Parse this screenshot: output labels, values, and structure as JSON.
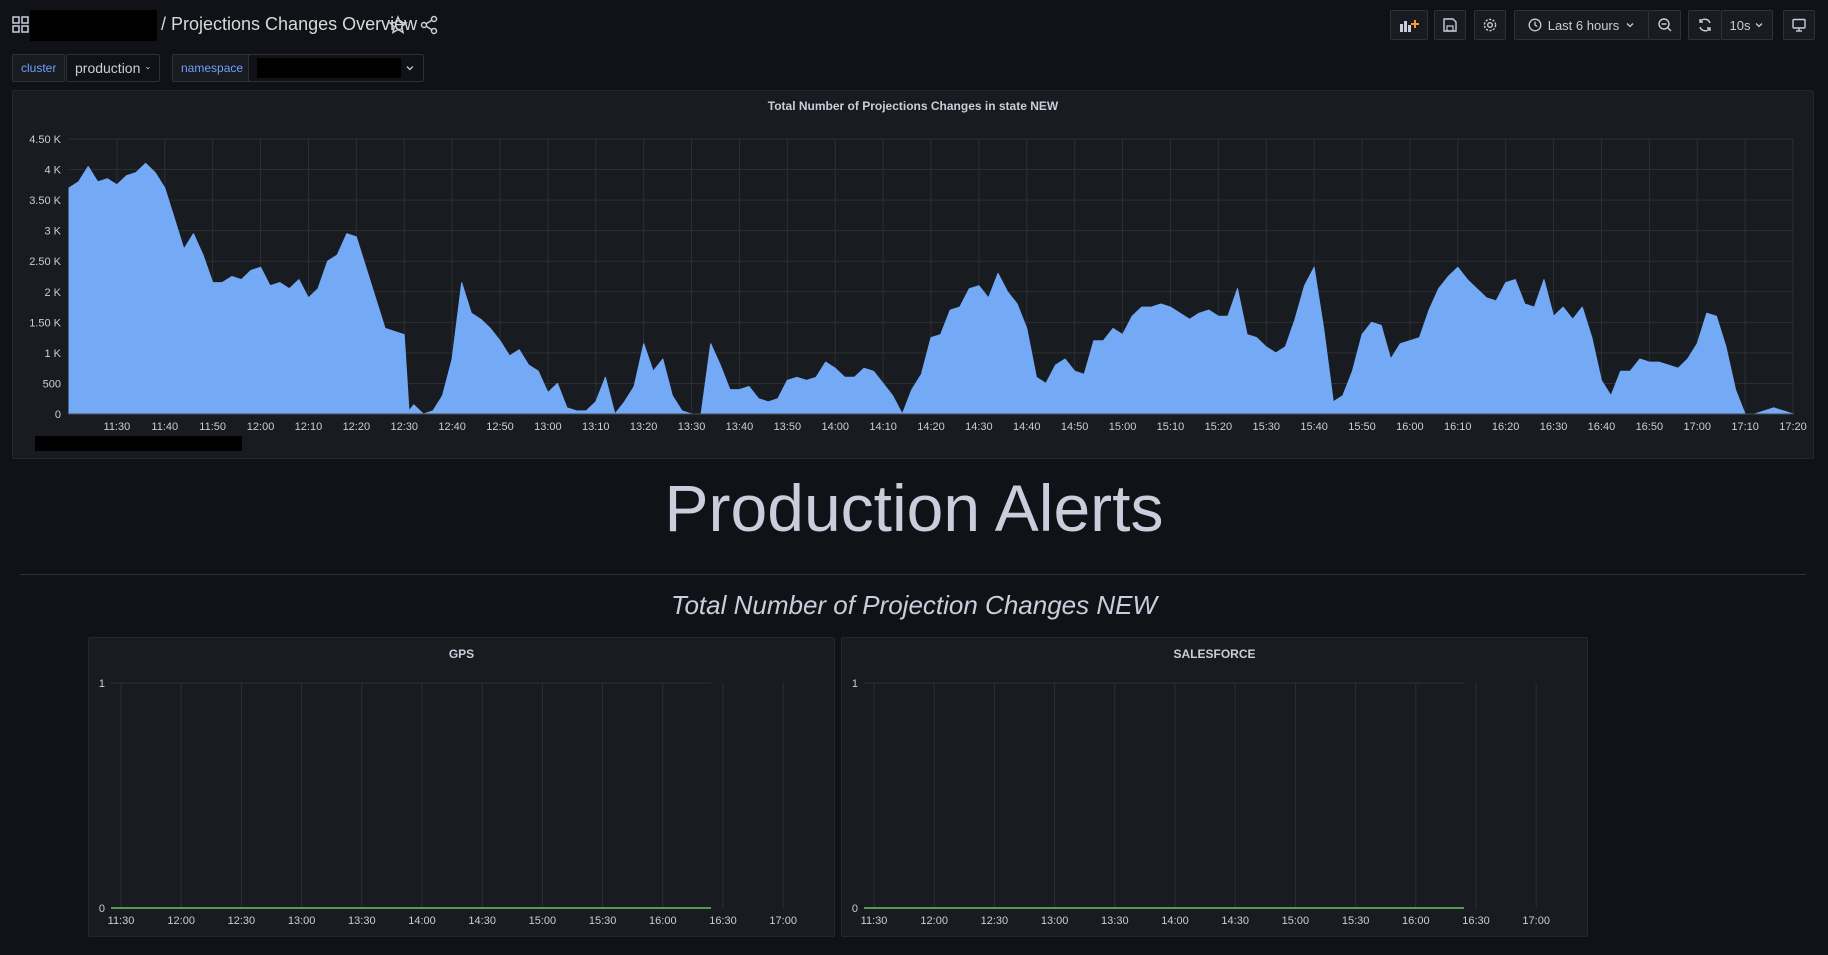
{
  "topnav": {
    "title": "/ Projections Changes Overview",
    "time_range": "Last 6 hours",
    "refresh_interval": "10s"
  },
  "variables": [
    {
      "label": "cluster",
      "value": "production"
    },
    {
      "label": "namespace",
      "value": ""
    }
  ],
  "heading": "Production Alerts",
  "subheading": "Total Number of Projection Changes NEW",
  "main_panel": {
    "title": "Total Number of Projections Changes in state NEW"
  },
  "gps_panel": {
    "title": "GPS"
  },
  "salesforce_panel": {
    "title": "SALESFORCE"
  },
  "colors": {
    "series": "#73a9f5",
    "flatline": "#73bf69",
    "background": "#111217",
    "panel": "#181b1f"
  },
  "chart_data": [
    {
      "type": "area",
      "title": "Total Number of Projections Changes in state NEW",
      "yticks": [
        "0",
        "500",
        "1 K",
        "1.50 K",
        "2 K",
        "2.50 K",
        "3 K",
        "3.50 K",
        "4 K",
        "4.50 K"
      ],
      "ylim": [
        0,
        4500
      ],
      "xlim": [
        "11:20",
        "17:20"
      ],
      "xticks": [
        "11:30",
        "11:40",
        "11:50",
        "12:00",
        "12:10",
        "12:20",
        "12:30",
        "12:40",
        "12:50",
        "13:00",
        "13:10",
        "13:20",
        "13:30",
        "13:40",
        "13:50",
        "14:00",
        "14:10",
        "14:20",
        "14:30",
        "14:40",
        "14:50",
        "15:00",
        "15:10",
        "15:20",
        "15:30",
        "15:40",
        "15:50",
        "16:00",
        "16:10",
        "16:20",
        "16:30",
        "16:40",
        "16:50",
        "17:00",
        "17:10",
        "17:20"
      ],
      "x": [
        "11:20",
        "11:22",
        "11:24",
        "11:26",
        "11:28",
        "11:30",
        "11:32",
        "11:34",
        "11:36",
        "11:38",
        "11:40",
        "11:42",
        "11:44",
        "11:46",
        "11:48",
        "11:50",
        "11:52",
        "11:54",
        "11:56",
        "11:58",
        "12:00",
        "12:02",
        "12:04",
        "12:06",
        "12:08",
        "12:10",
        "12:12",
        "12:14",
        "12:16",
        "12:18",
        "12:20",
        "12:22",
        "12:24",
        "12:26",
        "12:28",
        "12:30",
        "12:31",
        "12:32",
        "12:34",
        "12:36",
        "12:38",
        "12:40",
        "12:42",
        "12:44",
        "12:46",
        "12:48",
        "12:50",
        "12:52",
        "12:54",
        "12:56",
        "12:58",
        "13:00",
        "13:02",
        "13:04",
        "13:06",
        "13:08",
        "13:10",
        "13:12",
        "13:14",
        "13:16",
        "13:18",
        "13:20",
        "13:22",
        "13:24",
        "13:26",
        "13:28",
        "13:30",
        "13:32",
        "13:34",
        "13:36",
        "13:38",
        "13:40",
        "13:42",
        "13:44",
        "13:46",
        "13:48",
        "13:50",
        "13:52",
        "13:54",
        "13:56",
        "13:58",
        "14:00",
        "14:02",
        "14:04",
        "14:06",
        "14:08",
        "14:10",
        "14:12",
        "14:14",
        "14:16",
        "14:18",
        "14:20",
        "14:22",
        "14:24",
        "14:26",
        "14:28",
        "14:30",
        "14:32",
        "14:34",
        "14:36",
        "14:38",
        "14:40",
        "14:42",
        "14:44",
        "14:46",
        "14:48",
        "14:50",
        "14:52",
        "14:54",
        "14:56",
        "14:58",
        "15:00",
        "15:02",
        "15:04",
        "15:06",
        "15:08",
        "15:10",
        "15:12",
        "15:14",
        "15:16",
        "15:18",
        "15:20",
        "15:22",
        "15:24",
        "15:26",
        "15:28",
        "15:30",
        "15:32",
        "15:34",
        "15:36",
        "15:38",
        "15:40",
        "15:42",
        "15:44",
        "15:46",
        "15:48",
        "15:50",
        "15:52",
        "15:54",
        "15:56",
        "15:58",
        "16:00",
        "16:02",
        "16:04",
        "16:06",
        "16:08",
        "16:10",
        "16:12",
        "16:14",
        "16:16",
        "16:18",
        "16:20",
        "16:22",
        "16:24",
        "16:26",
        "16:28",
        "16:30",
        "16:32",
        "16:34",
        "16:36",
        "16:38",
        "16:40",
        "16:42",
        "16:44",
        "16:46",
        "16:48",
        "16:50",
        "16:52",
        "16:54",
        "16:56",
        "16:58",
        "17:00",
        "17:02",
        "17:04",
        "17:06",
        "17:08",
        "17:10",
        "17:12",
        "17:14",
        "17:16",
        "17:18",
        "17:20"
      ],
      "y": [
        3700,
        3800,
        4050,
        3800,
        3850,
        3750,
        3900,
        3950,
        4100,
        3950,
        3700,
        3200,
        2700,
        2950,
        2600,
        2150,
        2150,
        2250,
        2200,
        2350,
        2400,
        2100,
        2150,
        2050,
        2200,
        1900,
        2050,
        2500,
        2600,
        2950,
        2900,
        2400,
        1900,
        1400,
        1350,
        1300,
        50,
        150,
        0,
        50,
        300,
        900,
        2150,
        1650,
        1550,
        1400,
        1200,
        950,
        1050,
        800,
        700,
        350,
        500,
        100,
        50,
        50,
        200,
        600,
        0,
        200,
        450,
        1150,
        700,
        900,
        300,
        50,
        0,
        0,
        1150,
        800,
        400,
        400,
        450,
        250,
        200,
        250,
        550,
        600,
        550,
        600,
        850,
        750,
        600,
        600,
        750,
        700,
        500,
        300,
        0,
        400,
        650,
        1250,
        1300,
        1700,
        1750,
        2050,
        2100,
        1900,
        2300,
        2000,
        1800,
        1400,
        600,
        500,
        800,
        900,
        700,
        650,
        1200,
        1200,
        1400,
        1300,
        1600,
        1750,
        1750,
        1800,
        1750,
        1650,
        1550,
        1650,
        1700,
        1600,
        1600,
        2050,
        1300,
        1250,
        1100,
        1000,
        1100,
        1550,
        2100,
        2400,
        1400,
        200,
        300,
        700,
        1300,
        1500,
        1450,
        900,
        1150,
        1200,
        1250,
        1700,
        2050,
        2250,
        2400,
        2200,
        2050,
        1900,
        1850,
        2150,
        2200,
        1800,
        1750,
        2200,
        1600,
        1750,
        1550,
        1750,
        1250,
        550,
        300,
        700,
        700,
        900,
        850,
        850,
        800,
        750,
        900,
        1150,
        1650,
        1600,
        1100,
        400,
        0,
        0,
        50,
        100,
        50,
        0
      ]
    },
    {
      "type": "line",
      "title": "GPS",
      "yticks": [
        "0",
        "1"
      ],
      "ylim": [
        0,
        1
      ],
      "xticks": [
        "11:30",
        "12:00",
        "12:30",
        "13:00",
        "13:30",
        "14:00",
        "14:30",
        "15:00",
        "15:30",
        "16:00",
        "16:30",
        "17:00"
      ],
      "series": [
        {
          "values": [
            0,
            0
          ]
        }
      ]
    },
    {
      "type": "line",
      "title": "SALESFORCE",
      "yticks": [
        "0",
        "1"
      ],
      "ylim": [
        0,
        1
      ],
      "xticks": [
        "11:30",
        "12:00",
        "12:30",
        "13:00",
        "13:30",
        "14:00",
        "14:30",
        "15:00",
        "15:30",
        "16:00",
        "16:30",
        "17:00"
      ],
      "series": [
        {
          "values": [
            0,
            0
          ]
        }
      ]
    }
  ]
}
